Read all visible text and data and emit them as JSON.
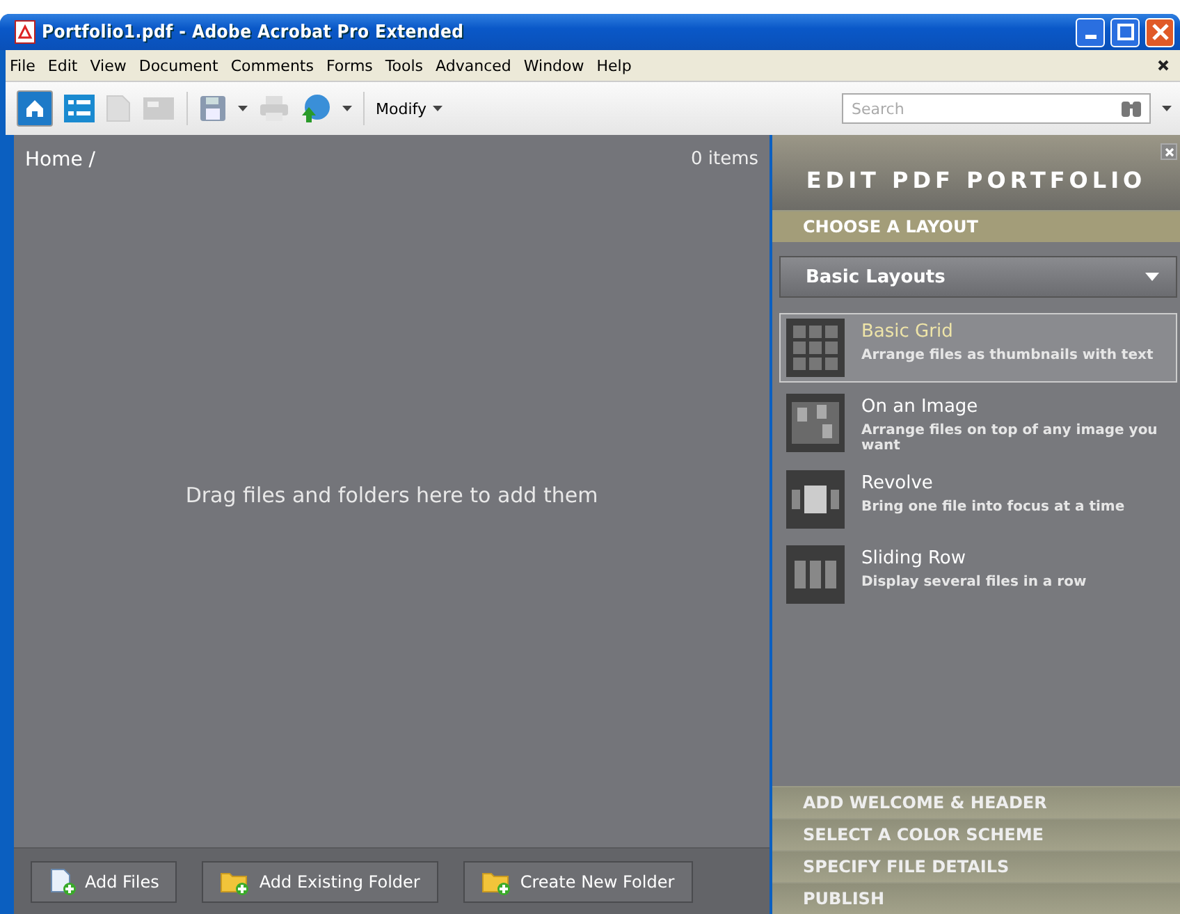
{
  "window": {
    "title": "Portfolio1.pdf - Adobe Acrobat Pro Extended"
  },
  "menu": [
    "File",
    "Edit",
    "View",
    "Document",
    "Comments",
    "Forms",
    "Tools",
    "Advanced",
    "Window",
    "Help"
  ],
  "toolbar": {
    "modify": "Modify",
    "search": {
      "placeholder": "Search"
    }
  },
  "view": {
    "breadcrumb": "Home /",
    "count": "0 items",
    "hint": "Drag files and folders here to add them"
  },
  "bottom_buttons": [
    {
      "kind": "file",
      "label": "Add Files"
    },
    {
      "kind": "folder",
      "label": "Add Existing Folder"
    },
    {
      "kind": "folder",
      "label": "Create New Folder"
    }
  ],
  "panel": {
    "title": "EDIT PDF PORTFOLIO",
    "section": "CHOOSE A LAYOUT",
    "dropdown": "Basic Layouts",
    "layouts": [
      {
        "kind": "grid",
        "name": "Basic Grid",
        "description": "Arrange files as thumbnails with text",
        "selected": true
      },
      {
        "kind": "image",
        "name": "On an Image",
        "description": "Arrange files on top of any image you want",
        "selected": false
      },
      {
        "kind": "revolve",
        "name": "Revolve",
        "description": "Bring one file into focus at a time",
        "selected": false
      },
      {
        "kind": "sliding",
        "name": "Sliding Row",
        "description": "Display several files in a row",
        "selected": false
      }
    ],
    "steps": [
      "ADD WELCOME & HEADER",
      "SELECT A COLOR SCHEME",
      "SPECIFY FILE DETAILS",
      "PUBLISH"
    ]
  }
}
